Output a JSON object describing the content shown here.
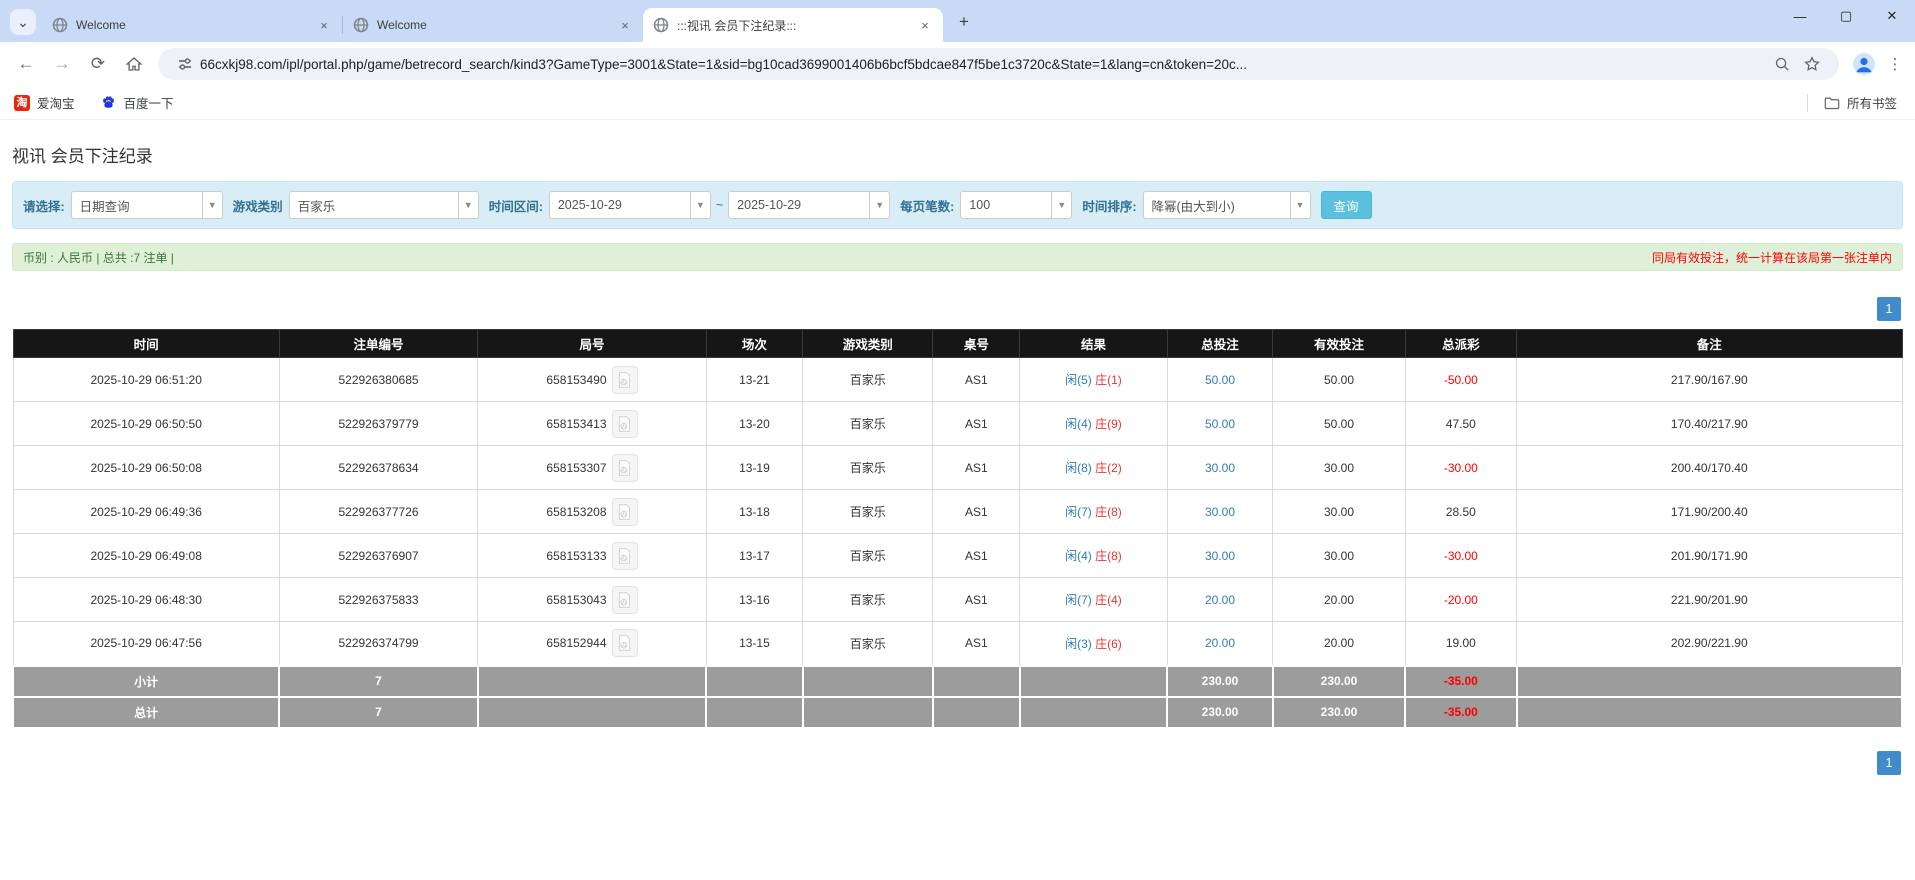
{
  "browser": {
    "tabs": [
      {
        "title": "Welcome",
        "active": false
      },
      {
        "title": "Welcome",
        "active": false
      },
      {
        "title": ":::视讯 会员下注纪录:::",
        "active": true
      }
    ],
    "url": "66cxkj98.com/ipl/portal.php/game/betrecord_search/kind3?GameType=3001&State=1&sid=bg10cad3699001406b6bcf5bdcae847f5be1c3720c&State=1&lang=cn&token=20c...",
    "bookmarks": {
      "taobao_glyph": "淘",
      "taobao": "爱淘宝",
      "baidu": "百度一下",
      "all_bookmarks": "所有书签"
    },
    "icons": {
      "back": "←",
      "forward": "→",
      "reload": "⟳",
      "home": "⌂",
      "chevron_down": "⌄",
      "plus": "+",
      "close": "✕",
      "minimize": "—",
      "maximize": "▢",
      "dots": "⋮"
    }
  },
  "page": {
    "title": "视讯 会员下注纪录",
    "filters": {
      "select_label": "请选择:",
      "select_value": "日期查询",
      "game_type_label": "游戏类别",
      "game_type_value": "百家乐",
      "time_range_label": "时间区间:",
      "date_from": "2025-10-29",
      "tilde": "~",
      "date_to": "2025-10-29",
      "per_page_label": "每页笔数:",
      "per_page_value": "100",
      "sort_label": "时间排序:",
      "sort_value": "降幂(由大到小)",
      "search_button": "查询",
      "dropdown_arrow": "▼"
    },
    "summary_bar": {
      "left": "币别 : 人民币 | 总共 :7 注单 |",
      "right": "同局有效投注，统一计算在该局第一张注单内"
    },
    "pagination": {
      "current": "1"
    },
    "table": {
      "headers": [
        "时间",
        "注单编号",
        "局号",
        "场次",
        "游戏类别",
        "桌号",
        "结果",
        "总投注",
        "有效投注",
        "总派彩",
        "备注"
      ],
      "col_widths": [
        "14.1%",
        "10.5%",
        "12.1%",
        "5.1%",
        "6.9%",
        "4.6%",
        "7.8%",
        "5.6%",
        "7.0%",
        "5.9%",
        "20.4%"
      ],
      "rows": [
        {
          "time": "2025-10-29 06:51:20",
          "bet_id": "522926380685",
          "round_id": "658153490",
          "session": "13-21",
          "game": "百家乐",
          "table": "AS1",
          "result_player": "闲(5)",
          "result_banker": "庄(1)",
          "total_bet": "50.00",
          "valid_bet": "50.00",
          "payout": "-50.00",
          "remark": "217.90/167.90"
        },
        {
          "time": "2025-10-29 06:50:50",
          "bet_id": "522926379779",
          "round_id": "658153413",
          "session": "13-20",
          "game": "百家乐",
          "table": "AS1",
          "result_player": "闲(4)",
          "result_banker": "庄(9)",
          "total_bet": "50.00",
          "valid_bet": "50.00",
          "payout": "47.50",
          "remark": "170.40/217.90"
        },
        {
          "time": "2025-10-29 06:50:08",
          "bet_id": "522926378634",
          "round_id": "658153307",
          "session": "13-19",
          "game": "百家乐",
          "table": "AS1",
          "result_player": "闲(8)",
          "result_banker": "庄(2)",
          "total_bet": "30.00",
          "valid_bet": "30.00",
          "payout": "-30.00",
          "remark": "200.40/170.40"
        },
        {
          "time": "2025-10-29 06:49:36",
          "bet_id": "522926377726",
          "round_id": "658153208",
          "session": "13-18",
          "game": "百家乐",
          "table": "AS1",
          "result_player": "闲(7)",
          "result_banker": "庄(8)",
          "total_bet": "30.00",
          "valid_bet": "30.00",
          "payout": "28.50",
          "remark": "171.90/200.40"
        },
        {
          "time": "2025-10-29 06:49:08",
          "bet_id": "522926376907",
          "round_id": "658153133",
          "session": "13-17",
          "game": "百家乐",
          "table": "AS1",
          "result_player": "闲(4)",
          "result_banker": "庄(8)",
          "total_bet": "30.00",
          "valid_bet": "30.00",
          "payout": "-30.00",
          "remark": "201.90/171.90"
        },
        {
          "time": "2025-10-29 06:48:30",
          "bet_id": "522926375833",
          "round_id": "658153043",
          "session": "13-16",
          "game": "百家乐",
          "table": "AS1",
          "result_player": "闲(7)",
          "result_banker": "庄(4)",
          "total_bet": "20.00",
          "valid_bet": "20.00",
          "payout": "-20.00",
          "remark": "221.90/201.90"
        },
        {
          "time": "2025-10-29 06:47:56",
          "bet_id": "522926374799",
          "round_id": "658152944",
          "session": "13-15",
          "game": "百家乐",
          "table": "AS1",
          "result_player": "闲(3)",
          "result_banker": "庄(6)",
          "total_bet": "20.00",
          "valid_bet": "20.00",
          "payout": "19.00",
          "remark": "202.90/221.90"
        }
      ],
      "subtotal": {
        "label": "小计",
        "count": "7",
        "total_bet": "230.00",
        "valid_bet": "230.00",
        "payout": "-35.00"
      },
      "total": {
        "label": "总计",
        "count": "7",
        "total_bet": "230.00",
        "valid_bet": "230.00",
        "payout": "-35.00"
      }
    }
  },
  "colors": {
    "tabstrip_bg": "#c9daf6",
    "filter_bg": "#d9edf7",
    "summary_bg": "#dff0d8",
    "header_bg": "#161616",
    "summary_row_bg": "#9c9c9c",
    "accent_blue": "#428bca",
    "button_blue": "#5bc0de",
    "link_blue": "#337ab7",
    "negative_red": "#ff0000",
    "banker_red": "#e83333",
    "green_text": "#3c763d"
  }
}
